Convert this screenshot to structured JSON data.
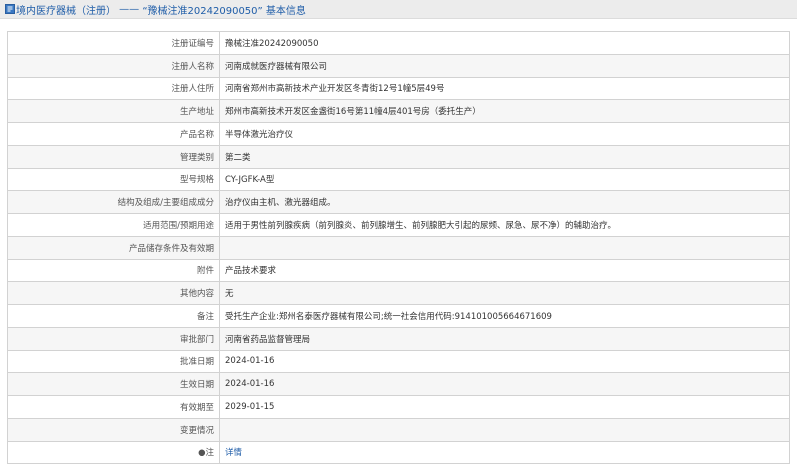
{
  "header": {
    "category": "境内医疗器械（注册）",
    "separator": " —— ",
    "reg_no_quoted": "“豫械注准20242090050”",
    "suffix": " 基本信息"
  },
  "rows": [
    {
      "label": "注册证编号",
      "value": "豫械注准20242090050"
    },
    {
      "label": "注册人名称",
      "value": "河南成就医疗器械有限公司"
    },
    {
      "label": "注册人住所",
      "value": "河南省郑州市高新技术产业开发区冬青街12号1幢5层49号"
    },
    {
      "label": "生产地址",
      "value": "郑州市高新技术开发区金盏街16号第11幢4层401号房（委托生产）"
    },
    {
      "label": "产品名称",
      "value": "半导体激光治疗仪"
    },
    {
      "label": "管理类别",
      "value": "第二类"
    },
    {
      "label": "型号规格",
      "value": "CY-JGFK-A型"
    },
    {
      "label": "结构及组成/主要组成成分",
      "value": "治疗仪由主机、激光器组成。"
    },
    {
      "label": "适用范围/预期用途",
      "value": "适用于男性前列腺疾病（前列腺炎、前列腺增生、前列腺肥大引起的尿频、尿急、尿不净）的辅助治疗。"
    },
    {
      "label": "产品储存条件及有效期",
      "value": ""
    },
    {
      "label": "附件",
      "value": "产品技术要求"
    },
    {
      "label": "其他内容",
      "value": "无"
    },
    {
      "label": "备注",
      "value": "受托生产企业:郑州名泰医疗器械有限公司;统一社会信用代码:91410100566467160​9"
    },
    {
      "label": "审批部门",
      "value": "河南省药品监督管理局"
    },
    {
      "label": "批准日期",
      "value": "2024-01-16"
    },
    {
      "label": "生效日期",
      "value": "2024-01-16"
    },
    {
      "label": "有效期至",
      "value": "2029-01-15"
    },
    {
      "label": "变更情况",
      "value": ""
    },
    {
      "label": "●注",
      "value": "详情"
    }
  ],
  "colors": {
    "title_text": "#1f5da8",
    "title_bg": "#ececec",
    "border": "#d2d2d2",
    "row_alt": "#f6f6f6",
    "link": "#1f5da8"
  },
  "icons": {
    "title_icon": "document-icon"
  }
}
